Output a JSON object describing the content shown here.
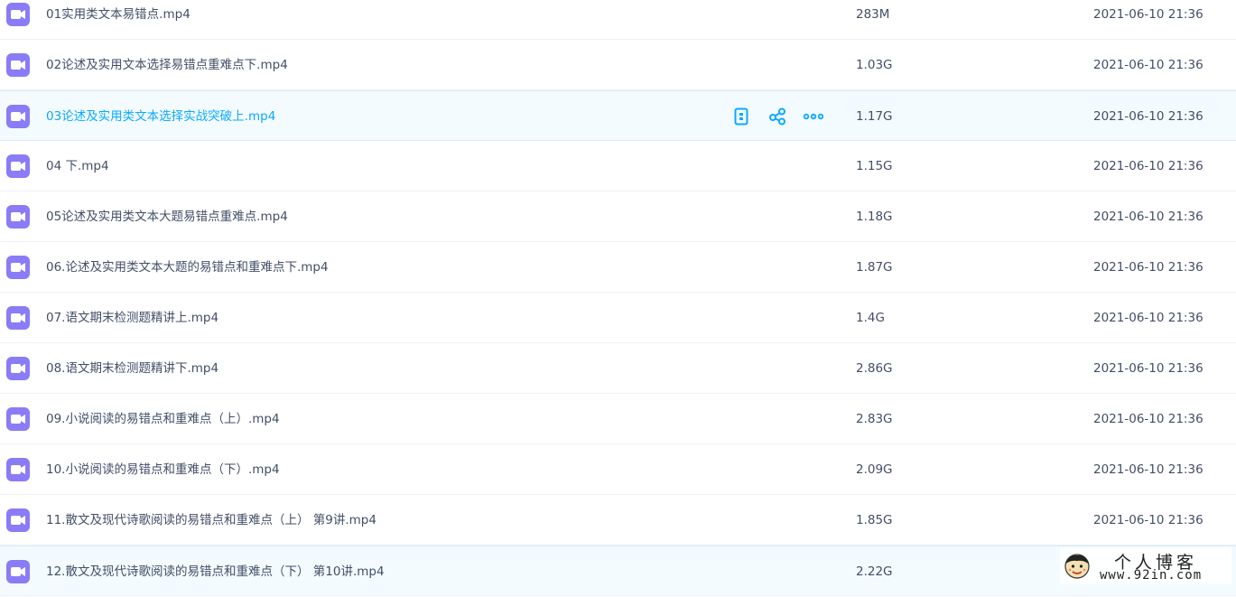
{
  "colors": {
    "text": "#424e67",
    "accent": "#09aaff",
    "icon_purple": "#8a7cf7",
    "row_highlight": "#f4fbff"
  },
  "files": [
    {
      "name": "01实用类文本易错点.mp4",
      "size": "283M",
      "date": "2021-06-10 21:36",
      "icon": "video-file-icon"
    },
    {
      "name": "02论述及实用文本选择易错点重难点下.mp4",
      "size": "1.03G",
      "date": "2021-06-10 21:36",
      "icon": "video-file-icon"
    },
    {
      "name": "03论述及实用类文本选择实战突破上.mp4",
      "size": "1.17G",
      "date": "2021-06-10 21:36",
      "icon": "video-file-icon",
      "highlighted": true
    },
    {
      "name": "04 下.mp4",
      "size": "1.15G",
      "date": "2021-06-10 21:36",
      "icon": "video-file-icon"
    },
    {
      "name": "05论述及实用类文本大题易错点重难点.mp4",
      "size": "1.18G",
      "date": "2021-06-10 21:36",
      "icon": "video-file-icon"
    },
    {
      "name": "06.论述及实用类文本大题的易错点和重难点下.mp4",
      "size": "1.87G",
      "date": "2021-06-10 21:36",
      "icon": "video-file-icon"
    },
    {
      "name": "07.语文期末检测题精讲上.mp4",
      "size": "1.4G",
      "date": "2021-06-10 21:36",
      "icon": "video-file-icon"
    },
    {
      "name": "08.语文期末检测题精讲下.mp4",
      "size": "2.86G",
      "date": "2021-06-10 21:36",
      "icon": "video-file-icon"
    },
    {
      "name": "09.小说阅读的易错点和重难点（上）.mp4",
      "size": "2.83G",
      "date": "2021-06-10 21:36",
      "icon": "video-file-icon"
    },
    {
      "name": "10.小说阅读的易错点和重难点（下）.mp4",
      "size": "2.09G",
      "date": "2021-06-10 21:36",
      "icon": "video-file-icon"
    },
    {
      "name": "11.散文及现代诗歌阅读的易错点和重难点（上） 第9讲.mp4",
      "size": "1.85G",
      "date": "2021-06-10 21:36",
      "icon": "video-file-icon"
    },
    {
      "name": "12.散文及现代诗歌阅读的易错点和重难点（下） 第10讲.mp4",
      "size": "2.22G",
      "date": "",
      "icon": "video-file-icon"
    }
  ],
  "row_actions": [
    {
      "name": "phone-icon"
    },
    {
      "name": "share-icon"
    },
    {
      "name": "more-icon"
    }
  ],
  "watermark": {
    "title": "个人博客",
    "url": "www.92in.com"
  }
}
